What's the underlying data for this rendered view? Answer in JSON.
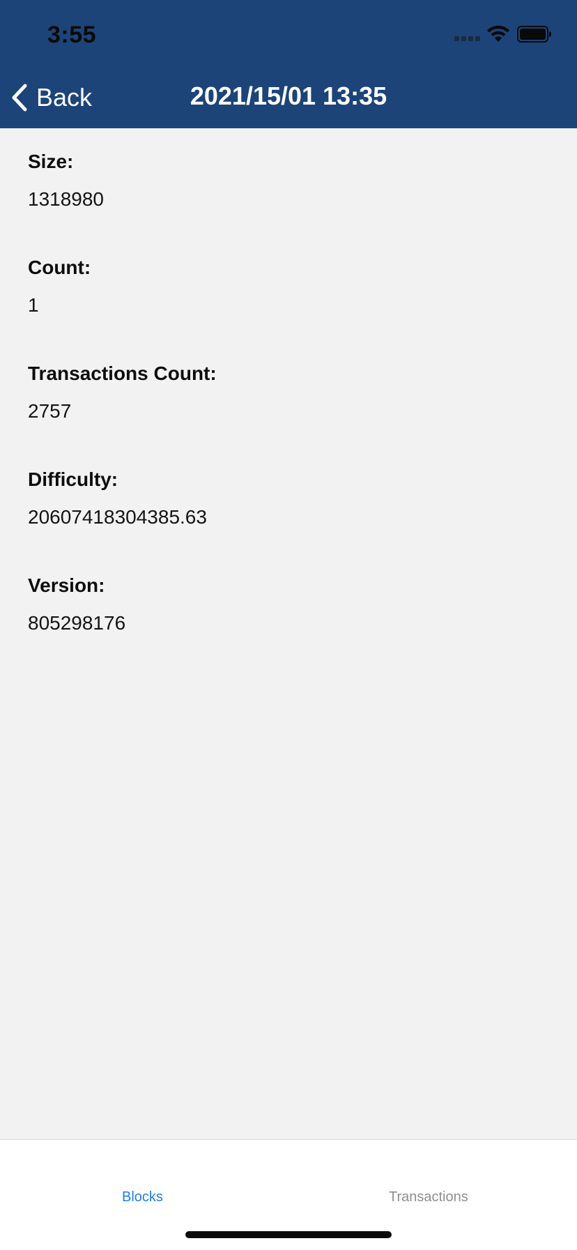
{
  "status_bar": {
    "time": "3:55"
  },
  "nav": {
    "back_label": "Back",
    "title": "2021/15/01 13:35"
  },
  "fields": [
    {
      "label": "Size:",
      "value": "1318980"
    },
    {
      "label": "Count:",
      "value": "1"
    },
    {
      "label": "Transactions Count:",
      "value": "2757"
    },
    {
      "label": "Difficulty:",
      "value": "20607418304385.63"
    },
    {
      "label": "Version:",
      "value": "805298176"
    }
  ],
  "tabs": [
    {
      "label": "Blocks",
      "active": true
    },
    {
      "label": "Transactions",
      "active": false
    }
  ],
  "colors": {
    "header_background": "#1c4478",
    "content_background": "#f2f2f2",
    "active_tab": "#1e7fe0",
    "inactive_tab": "#8f8f8f"
  }
}
